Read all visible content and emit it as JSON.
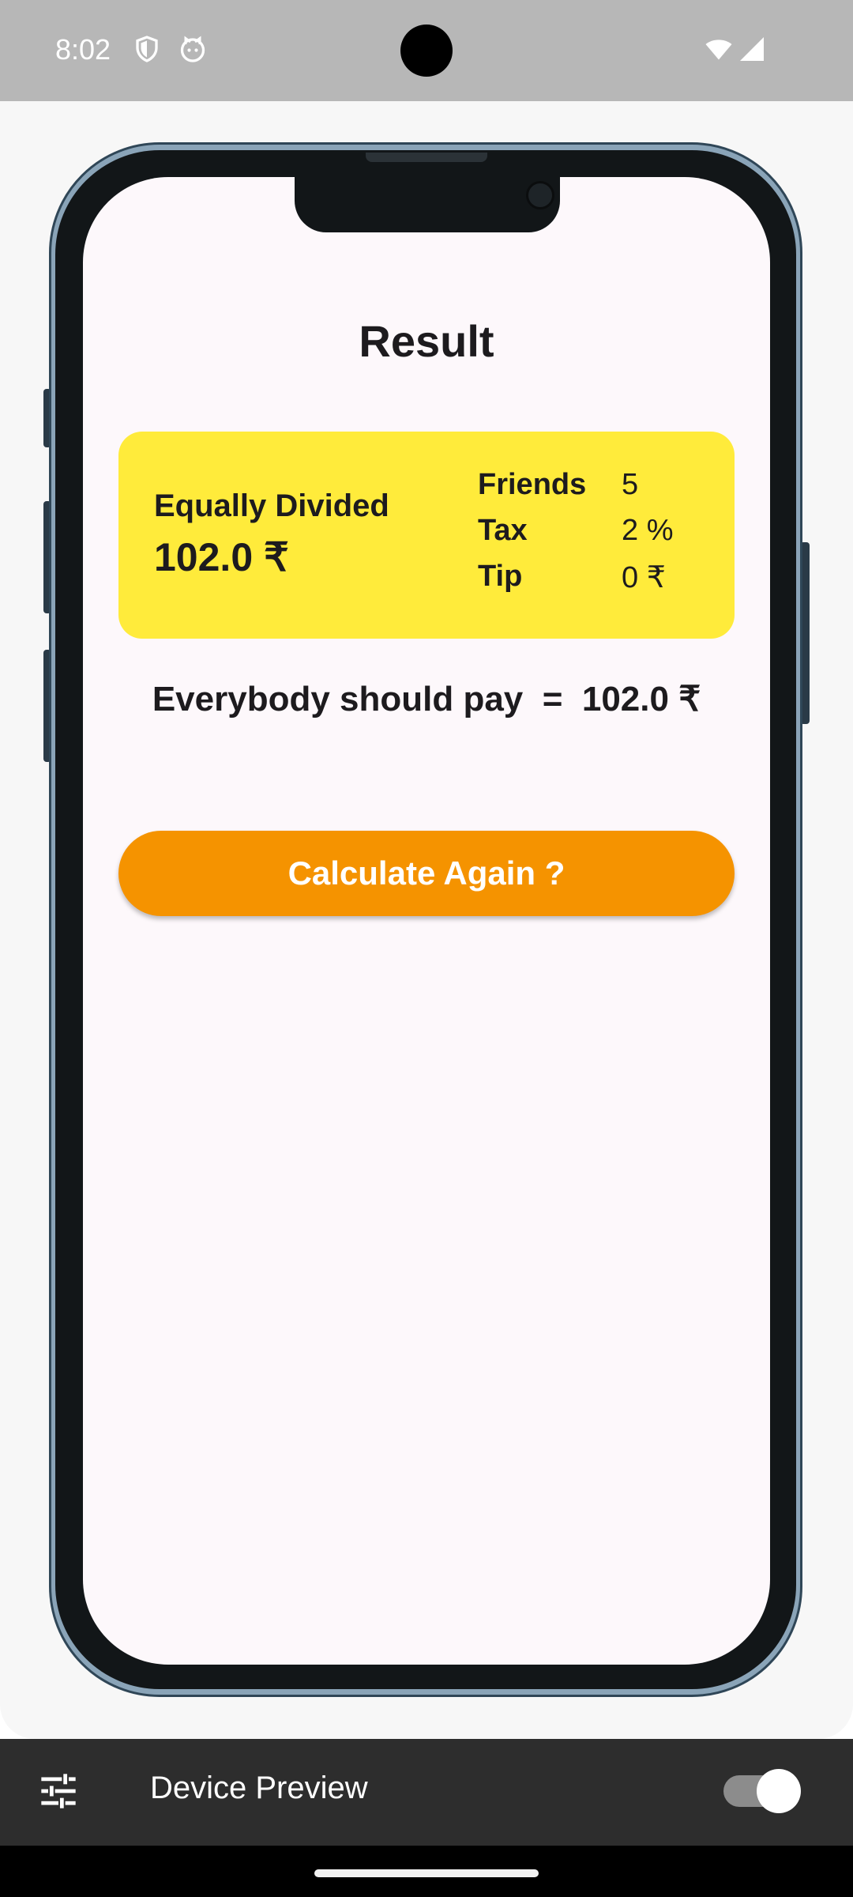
{
  "status_bar": {
    "time": "8:02"
  },
  "screen": {
    "title": "Result",
    "card": {
      "label": "Equally Divided",
      "amount": "102.0 ₹",
      "details": [
        {
          "key": "Friends",
          "value": "5"
        },
        {
          "key": "Tax",
          "value": "2 %"
        },
        {
          "key": "Tip",
          "value": "0 ₹"
        }
      ]
    },
    "pay_line": "Everybody should pay  =  102.0 ₹",
    "action_button": "Calculate Again ?"
  },
  "device_preview": {
    "label": "Device Preview",
    "toggle_on": true
  },
  "colors": {
    "card": "#ffeb3b",
    "button": "#f59300",
    "screen_bg": "#fdf8fb"
  }
}
